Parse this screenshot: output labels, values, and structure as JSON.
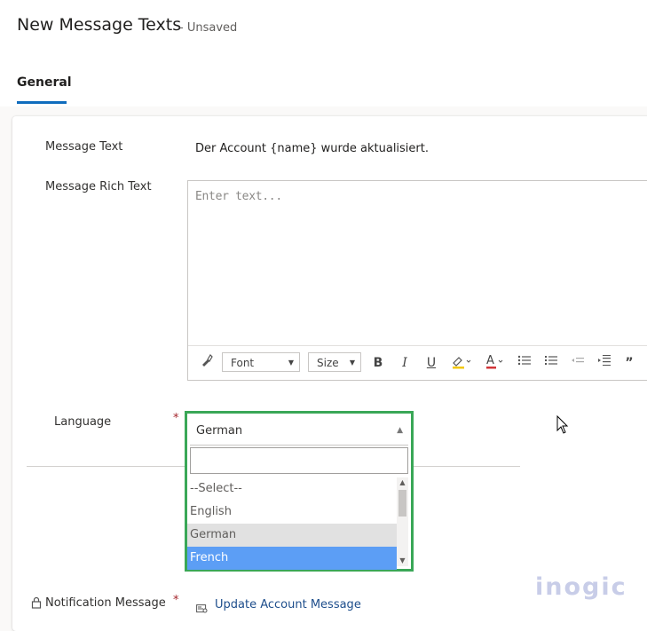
{
  "header": {
    "title": "New Message Texts",
    "status": "- Unsaved",
    "tab": "General"
  },
  "form": {
    "message_text_label": "Message Text",
    "message_text_value": "Der Account {name} wurde aktualisiert.",
    "rich_text_label": "Message Rich Text",
    "rich_text_placeholder": "Enter text...",
    "toolbar": {
      "font_label": "Font",
      "size_label": "Size",
      "icons": [
        "paint-format-icon",
        "bold-icon",
        "italic-icon",
        "underline-icon",
        "highlight-icon",
        "font-color-icon",
        "bullet-list-icon",
        "numbered-list-icon",
        "outdent-icon",
        "indent-icon",
        "quote-icon"
      ]
    },
    "language_label": "Language",
    "required_marker": "*",
    "language_selected": "German",
    "language_options": [
      "--Select--",
      "English",
      "German",
      "French"
    ],
    "notification_label": "Notification Message",
    "notification_value": "Update Account Message"
  },
  "brand": {
    "logo": "inogic"
  },
  "colors": {
    "highlight_border": "#3aa757",
    "selected_option": "#5c9ef5",
    "link": "#1e4e8c",
    "tab_underline": "#0f6cbd"
  }
}
